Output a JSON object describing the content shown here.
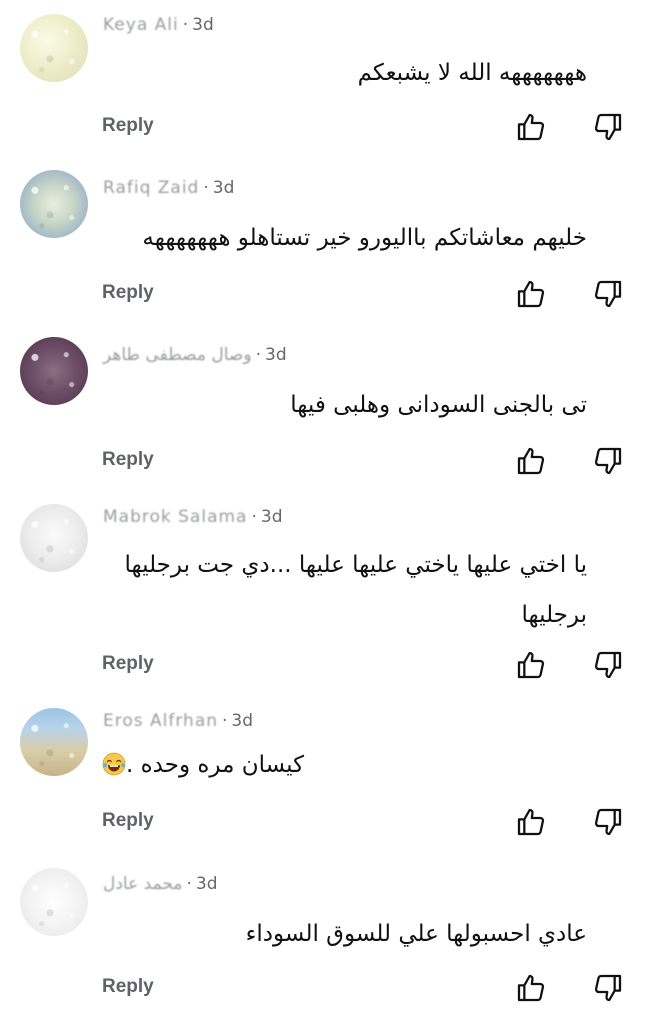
{
  "comments": [
    {
      "author": "Keya Ali",
      "time": "3d",
      "text": "هههههههه الله لا يشبعكم",
      "reply_label": "Reply"
    },
    {
      "author": "Rafiq Zaid",
      "time": "3d",
      "text": "خليهم معاشاتكم بااليورو خير تستاهلو هههههههه",
      "reply_label": "Reply"
    },
    {
      "author": "وصال مصطفى طاهر",
      "time": "3d",
      "text": "تى بالجنى السودانى وهلبى فيها",
      "reply_label": "Reply"
    },
    {
      "author": "Mabrok Salama",
      "time": "3d",
      "text": "يا اختي عليها ياختي عليها عليها ...دي جت برجليها برجليها",
      "reply_label": "Reply"
    },
    {
      "author": "Eros Alfrhan",
      "time": "3d",
      "text": "كيسان مره وحده .",
      "emoji": "face-with-tears-of-joy",
      "reply_label": "Reply"
    },
    {
      "author": "محمد عادل",
      "time": "3d",
      "text": "عادي احسبولها علي للسوق السوداء",
      "reply_label": "Reply"
    }
  ],
  "icons": {
    "like": "thumbs-up-outline",
    "dislike": "thumbs-down-outline"
  },
  "colors": {
    "background": "#ffffff",
    "meta_text": "#65676b",
    "body_text": "#111111",
    "reply_text": "#5f6368",
    "icon_stroke": "#111111"
  }
}
